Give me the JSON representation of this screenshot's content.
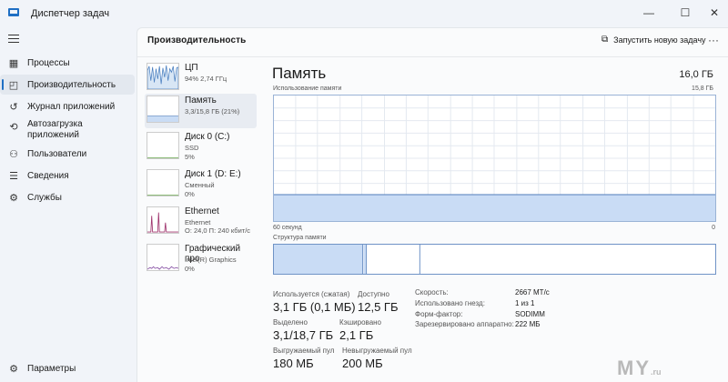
{
  "window": {
    "title": "Диспетчер задач",
    "controls": {
      "minimize": "—",
      "maximize": "☐",
      "close": "✕"
    }
  },
  "sidebar": {
    "items": [
      {
        "icon": "grid-icon",
        "label": "Процессы"
      },
      {
        "icon": "performance-icon",
        "label": "Производительность",
        "active": true
      },
      {
        "icon": "history-icon",
        "label": "Журнал приложений"
      },
      {
        "icon": "startup-icon",
        "label": "Автозагрузка приложений"
      },
      {
        "icon": "users-icon",
        "label": "Пользователи"
      },
      {
        "icon": "list-icon",
        "label": "Сведения"
      },
      {
        "icon": "services-icon",
        "label": "Службы"
      }
    ],
    "settings_label": "Параметры"
  },
  "header": {
    "title": "Производительность",
    "run_task_label": "Запустить новую задачу",
    "more": "···"
  },
  "resources": [
    {
      "name": "ЦП",
      "line1": "94% 2,74 ГГц",
      "line2": ""
    },
    {
      "name": "Память",
      "line1": "3,3/15,8 ГБ (21%)",
      "line2": "",
      "active": true
    },
    {
      "name": "Диск 0 (C:)",
      "line1": "SSD",
      "line2": "5%"
    },
    {
      "name": "Диск 1 (D: E:)",
      "line1": "Сменный",
      "line2": "0%"
    },
    {
      "name": "Ethernet",
      "line1": "Ethernet",
      "line2": "О: 24,0 П: 240 кбит/с"
    },
    {
      "name": "Графический про",
      "line1": "Intel(R) Graphics",
      "line2": "0%"
    }
  ],
  "memory": {
    "title": "Память",
    "total": "16,0 ГБ",
    "usage_label": "Использование памяти",
    "usage_max": "15,8 ГБ",
    "axis_left": "60 секунд",
    "axis_right": "0",
    "usage_fraction": 0.21,
    "structure_label": "Структура памяти",
    "stats": {
      "in_use_label": "Используется (сжатая)",
      "in_use_value": "3,1 ГБ (0,1 МБ)",
      "available_label": "Доступно",
      "available_value": "12,5 ГБ",
      "committed_label": "Выделено",
      "committed_value": "3,1/18,7 ГБ",
      "cached_label": "Кэшировано",
      "cached_value": "2,1 ГБ",
      "paged_label": "Выгружаемый пул",
      "paged_value": "180 МБ",
      "nonpaged_label": "Невыгружаемый пул",
      "nonpaged_value": "200 МБ"
    },
    "details": [
      {
        "label": "Скорость:",
        "value": "2667 МТ/с"
      },
      {
        "label": "Использовано гнезд:",
        "value": "1 из 1"
      },
      {
        "label": "Форм-фактор:",
        "value": "SODIMM"
      },
      {
        "label": "Зарезервировано аппаратно:",
        "value": "222 МБ"
      }
    ]
  },
  "watermark": {
    "main": "MY",
    "suffix": ".ru"
  },
  "colors": {
    "accent": "#1f6fc4",
    "memory_fill": "#c9dcf5",
    "memory_line": "#6f93c6",
    "cpu_fill": "#d8e6f5",
    "ethernet_line": "#a0356e",
    "gpu_line": "#7a3e9a"
  }
}
